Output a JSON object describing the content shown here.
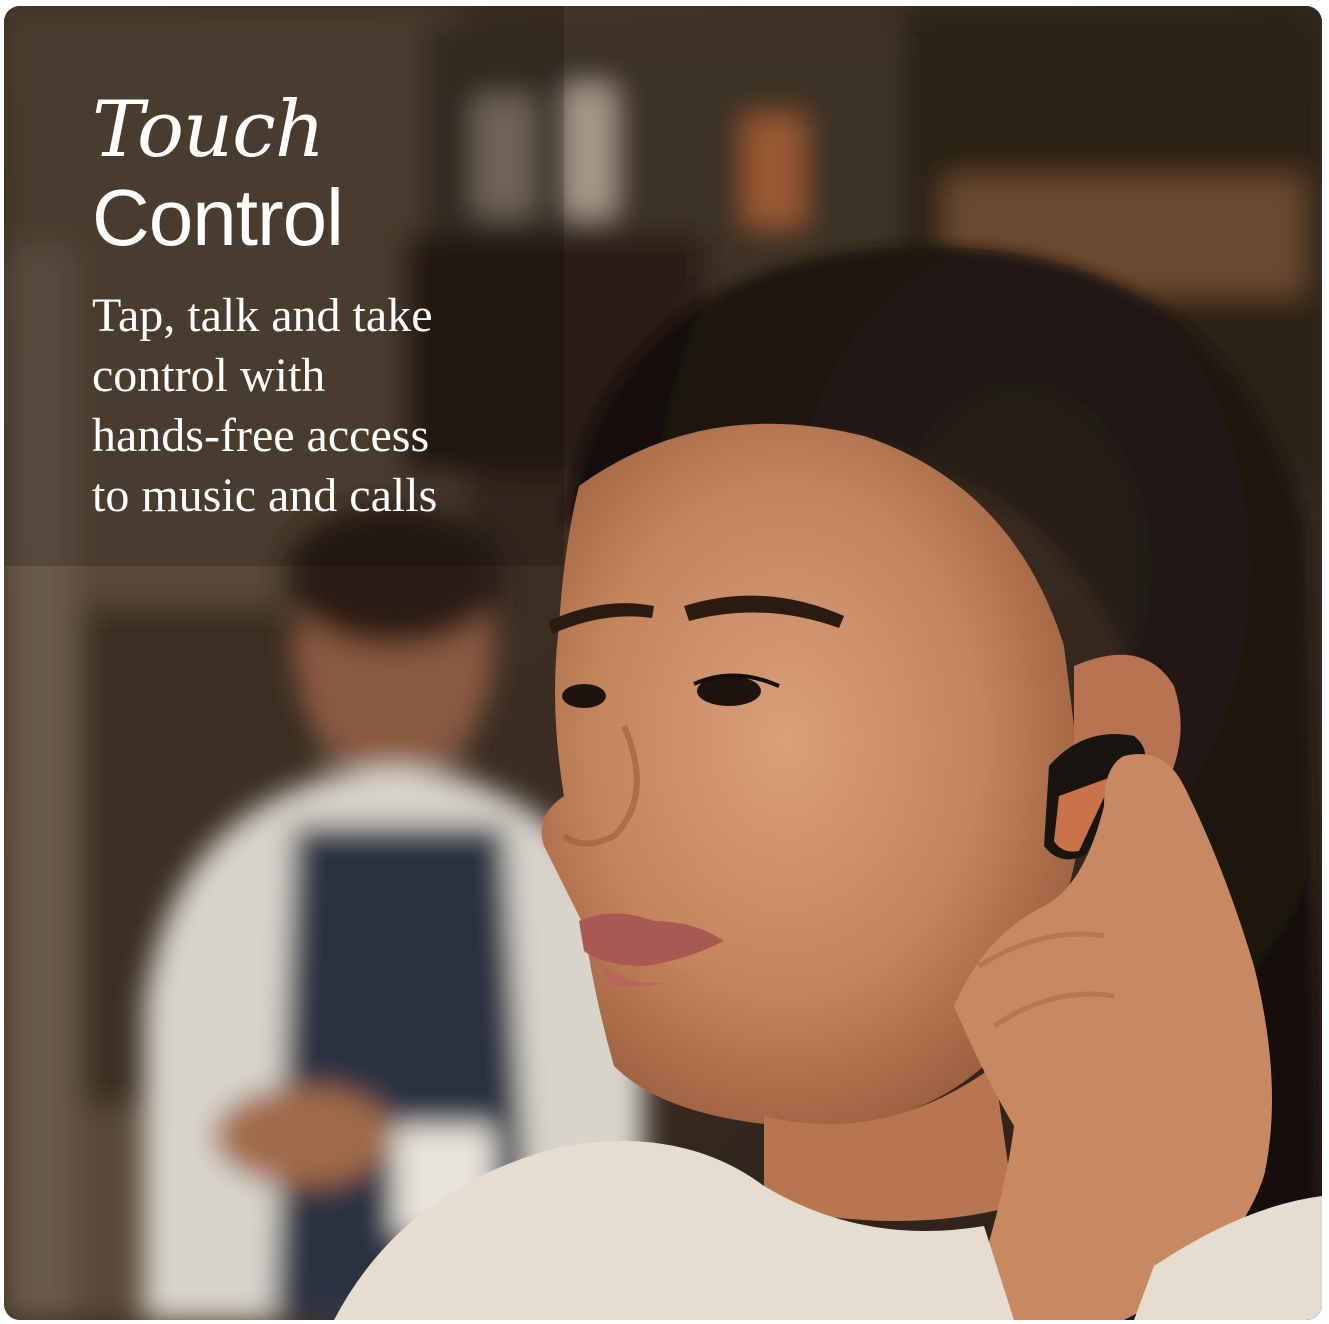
{
  "headline": {
    "line1": "Touch",
    "line2": "Control"
  },
  "description": "Tap, talk and take\ncontrol with\nhands-free access\nto music and calls",
  "colors": {
    "text": "#ffffff",
    "earbud_accent": "#c9734a"
  },
  "icons": {
    "earbud": "earbud-icon"
  }
}
